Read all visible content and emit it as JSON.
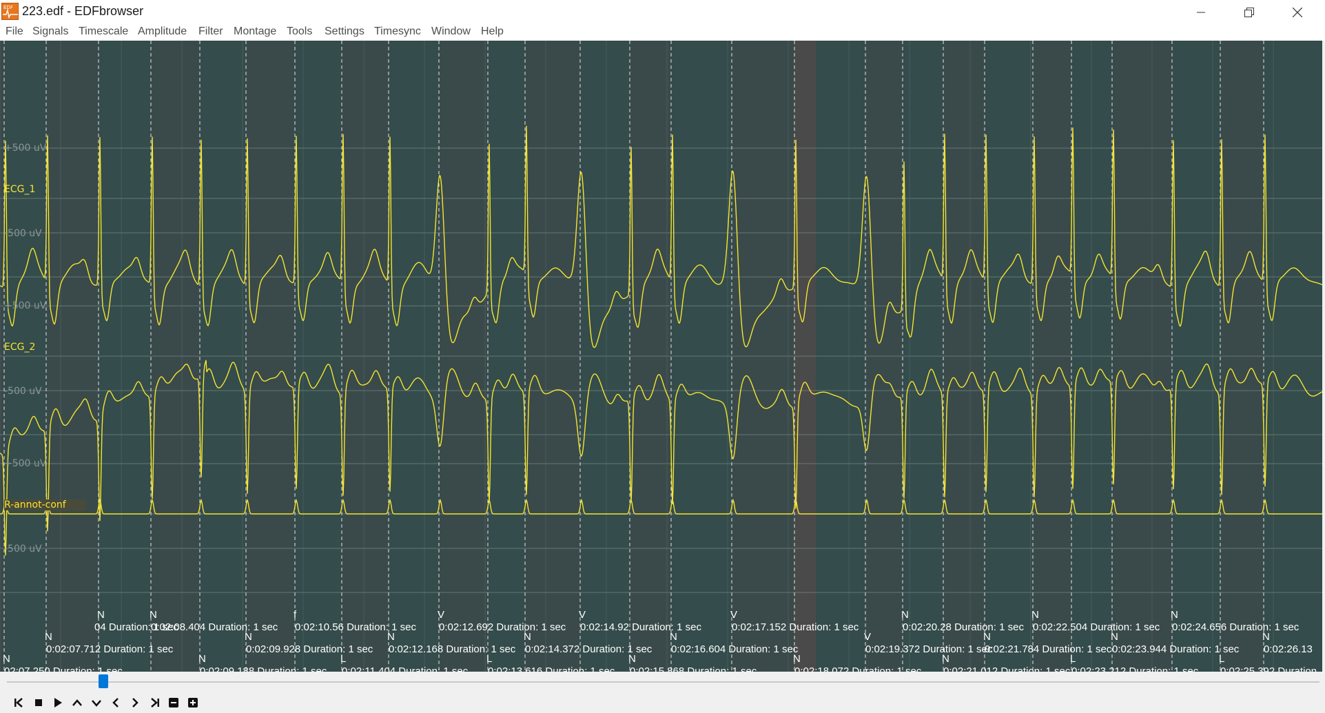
{
  "window": {
    "title": "223.edf - EDFbrowser",
    "icon": "edf-app-icon",
    "icon_text": "EDF",
    "controls": [
      "minimize-icon",
      "restore-icon",
      "close-icon"
    ]
  },
  "menu": [
    "File",
    "Signals",
    "Timescale",
    "Amplitude",
    "Filter",
    "Montage",
    "Tools",
    "Settings",
    "Timesync",
    "Window",
    "Help"
  ],
  "signals": [
    {
      "label": "ECG_1",
      "upper_scale": "+500 uV",
      "lower_scale": "-500 uV"
    },
    {
      "label": "ECG_2",
      "upper_scale": "+500 uV",
      "lower_scale": "-500 uV"
    },
    {
      "label": "R-annot-conf",
      "upper_scale": "+500 uV",
      "lower_scale": "-500 uV"
    }
  ],
  "colors": {
    "background": "#3a4a4a",
    "trace": "#f5e531",
    "annotation_text": "#ffffff",
    "annotation_marker": "#e6e6e6"
  },
  "annotations": [
    {
      "type_label": "N",
      "text": "02:07.250 Duration: 1 sec"
    },
    {
      "type_label": "N",
      "text": "0:02:07.712 Duration: 1 sec"
    },
    {
      "type_label": "N",
      "text": "04 Duration: 1 sec"
    },
    {
      "type_label": "N",
      "text": "0:02:08.404 Duration: 1 sec"
    },
    {
      "type_label": "N",
      "text": "0:02:09.188 Duration: 1 sec"
    },
    {
      "type_label": "N",
      "text": "0:02:09.928 Duration: 1 sec"
    },
    {
      "type_label": "f",
      "text": "0:02:10.56 Duration: 1 sec"
    },
    {
      "type_label": "L",
      "text": "0:02:11.404 Duration: 1 sec"
    },
    {
      "type_label": "N",
      "text": "0:02:12.168 Duration: 1 sec"
    },
    {
      "type_label": "V",
      "text": "0:02:12.692 Duration: 1 sec"
    },
    {
      "type_label": "L",
      "text": "0:02:13.616 Duration: 1 sec"
    },
    {
      "type_label": "N",
      "text": "0:02:14.372 Duration: 1 sec"
    },
    {
      "type_label": "V",
      "text": "0:02:14.92 Duration: 1 sec"
    },
    {
      "type_label": "N",
      "text": "0:02:15.868 Duration: 1 sec"
    },
    {
      "type_label": "N",
      "text": "0:02:16.604 Duration: 1 sec"
    },
    {
      "type_label": "V",
      "text": "0:02:17.152 Duration: 1 sec"
    },
    {
      "type_label": "N",
      "text": "0:02:18.072 Duration: 1 sec"
    },
    {
      "type_label": "V",
      "text": "0:02:19.372 Duration: 1 sec"
    },
    {
      "type_label": "N",
      "text": "0:02:20.28 Duration: 1 sec"
    },
    {
      "type_label": "N",
      "text": "0:02:21.012 Duration: 1 sec"
    },
    {
      "type_label": "N",
      "text": "0:02:21.784 Duration: 1 sec"
    },
    {
      "type_label": "N",
      "text": "0:02:22.504 Duration: 1 sec"
    },
    {
      "type_label": "L",
      "text": "0:02:23.212 Duration: 1 sec"
    },
    {
      "type_label": "N",
      "text": "0:02:23.944 Duration: 1 sec"
    },
    {
      "type_label": "N",
      "text": "0:02:24.656 Duration: 1 sec"
    },
    {
      "type_label": "L",
      "text": "0:02:25.392 Duration"
    },
    {
      "type_label": "N",
      "text": "0:02:26.13"
    }
  ],
  "playback_controls": [
    "skip-to-start-icon",
    "stop-icon",
    "play-icon",
    "scroll-up-icon",
    "scroll-down-icon",
    "step-back-icon",
    "step-forward-icon",
    "skip-to-end-icon",
    "zoom-out-icon",
    "zoom-in-icon"
  ],
  "scroll_position": 0.07
}
